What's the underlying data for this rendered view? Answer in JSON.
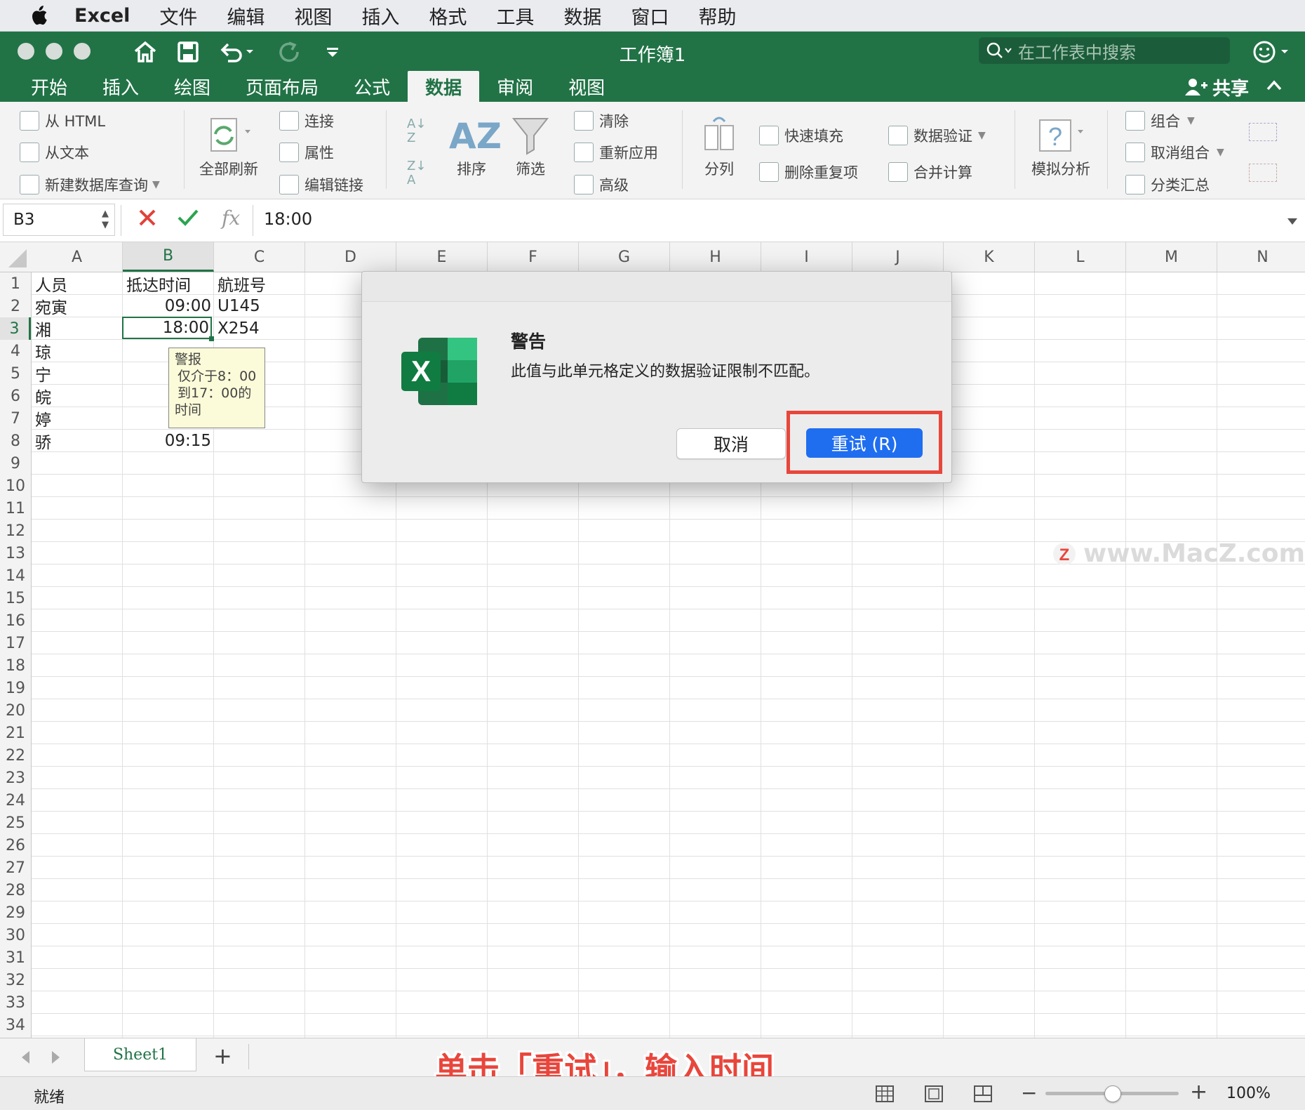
{
  "menubar": {
    "app": "Excel",
    "items": [
      "文件",
      "编辑",
      "视图",
      "插入",
      "格式",
      "工具",
      "数据",
      "窗口",
      "帮助"
    ]
  },
  "window": {
    "title": "工作簿1",
    "search_placeholder": "在工作表中搜索"
  },
  "tabs": [
    {
      "label": "开始",
      "active": false
    },
    {
      "label": "插入",
      "active": false
    },
    {
      "label": "绘图",
      "active": false
    },
    {
      "label": "页面布局",
      "active": false
    },
    {
      "label": "公式",
      "active": false
    },
    {
      "label": "数据",
      "active": true
    },
    {
      "label": "审阅",
      "active": false
    },
    {
      "label": "视图",
      "active": false
    }
  ],
  "share_label": "共享",
  "ribbon": {
    "from_html": "从 HTML",
    "from_text": "从文本",
    "new_db_query": "新建数据库查询",
    "refresh_all": "全部刷新",
    "connections": "连接",
    "properties": "属性",
    "edit_links": "编辑链接",
    "sort": "排序",
    "filter": "筛选",
    "clear": "清除",
    "reapply": "重新应用",
    "advanced": "高级",
    "text_to_columns": "分列",
    "flash_fill": "快速填充",
    "remove_duplicates": "删除重复项",
    "data_validation": "数据验证",
    "consolidate": "合并计算",
    "what_if": "模拟分析",
    "group": "组合",
    "ungroup": "取消组合",
    "subtotal": "分类汇总"
  },
  "formula_bar": {
    "name_box": "B3",
    "fx": "fx",
    "value": "18:00"
  },
  "columns": [
    "A",
    "B",
    "C",
    "D",
    "E",
    "F",
    "G",
    "H",
    "I",
    "J",
    "K",
    "L",
    "M",
    "N"
  ],
  "rows": [
    "1",
    "2",
    "3",
    "4",
    "5",
    "6",
    "7",
    "8",
    "9",
    "10",
    "11",
    "12",
    "13",
    "14",
    "15",
    "16",
    "17",
    "18",
    "19",
    "20",
    "21",
    "22",
    "23",
    "24",
    "25",
    "26",
    "27",
    "28",
    "29",
    "30",
    "31",
    "32",
    "33",
    "34"
  ],
  "cells": {
    "A1": "人员",
    "B1": "抵达时间",
    "C1": "航班号",
    "A2": "宛寅",
    "B2": "09:00",
    "C2": "U145",
    "A3": "湘",
    "B3": "18:00",
    "C3": "X254",
    "A4": "琼",
    "A5": "宁",
    "A6": "皖",
    "A7": "婷",
    "A8": "骄",
    "B8": "09:15"
  },
  "tooltip": {
    "title": "警报",
    "line1": "仅介于8：00",
    "line2": "到17：00的",
    "line3": "时间"
  },
  "dialog": {
    "title": "警告",
    "message": "此值与此单元格定义的数据验证限制不匹配。",
    "cancel": "取消",
    "retry": "重试 (R)",
    "highlight_color": "#e8463c"
  },
  "watermark": "www.MacZ.com",
  "sheet_tabs": [
    "Sheet1"
  ],
  "annotation": "单击「重试」，输入时间",
  "status": {
    "ready": "就绪",
    "zoom": "100%",
    "zoom_level": 0.5
  },
  "colors": {
    "excel_green": "#217346",
    "primary_button": "#1f6ef0"
  }
}
